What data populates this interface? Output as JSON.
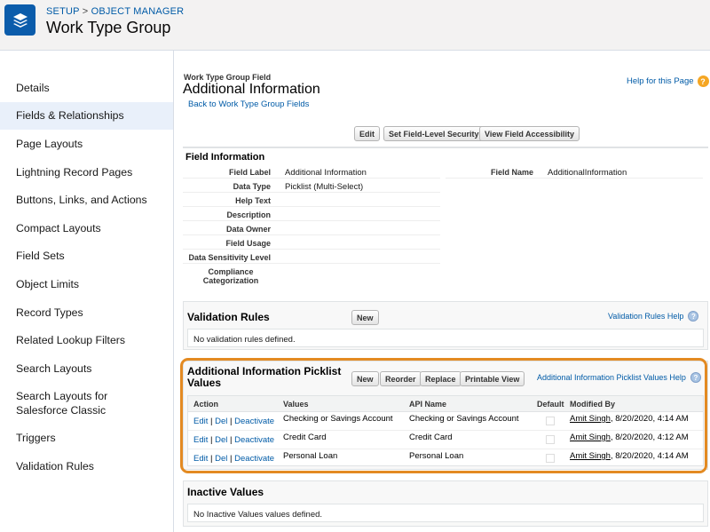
{
  "header": {
    "breadcrumb_setup": "SETUP",
    "breadcrumb_sep": ">",
    "breadcrumb_object_manager": "OBJECT MANAGER",
    "title": "Work Type Group",
    "icon": "layers-icon",
    "icon_color": "#0b5cab"
  },
  "sidebar": {
    "items": [
      {
        "label": "Details"
      },
      {
        "label": "Fields & Relationships"
      },
      {
        "label": "Page Layouts"
      },
      {
        "label": "Lightning Record Pages"
      },
      {
        "label": "Buttons, Links, and Actions"
      },
      {
        "label": "Compact Layouts"
      },
      {
        "label": "Field Sets"
      },
      {
        "label": "Object Limits"
      },
      {
        "label": "Record Types"
      },
      {
        "label": "Related Lookup Filters"
      },
      {
        "label": "Search Layouts"
      },
      {
        "label": "Search Layouts for Salesforce Classic"
      },
      {
        "label": "Triggers"
      },
      {
        "label": "Validation Rules"
      }
    ],
    "active": "Fields & Relationships"
  },
  "main": {
    "caption": "Work Type Group Field",
    "title": "Additional Information",
    "back_link": "Back to Work Type Group Fields",
    "help_link": "Help for this Page",
    "help_icon": "help-orange-icon",
    "buttons": {
      "edit": "Edit",
      "set_fls": "Set Field-Level Security",
      "view_access": "View Field Accessibility"
    }
  },
  "field_info": {
    "title": "Field Information",
    "rows": [
      {
        "label": "Field Label",
        "value": "Additional Information"
      },
      {
        "label": "Data Type",
        "value": "Picklist (Multi-Select)"
      },
      {
        "label": "Help Text",
        "value": ""
      },
      {
        "label": "Description",
        "value": ""
      },
      {
        "label": "Data Owner",
        "value": ""
      },
      {
        "label": "Field Usage",
        "value": ""
      },
      {
        "label": "Data Sensitivity Level",
        "value": ""
      },
      {
        "label": "Compliance Categorization",
        "value": ""
      }
    ],
    "field_name_label": "Field Name",
    "field_name_value": "AdditionalInformation"
  },
  "validation_rules": {
    "title": "Validation Rules",
    "new_button": "New",
    "help_link": "Validation Rules Help",
    "empty_text": "No validation rules defined."
  },
  "picklist": {
    "title_line1": "Additional Information Picklist",
    "title_line2": "Values",
    "buttons": {
      "new": "New",
      "reorder": "Reorder",
      "replace": "Replace",
      "printable": "Printable View"
    },
    "help_link": "Additional Information Picklist Values Help",
    "columns": [
      "Action",
      "Values",
      "API Name",
      "Default",
      "Modified By"
    ],
    "action_links": {
      "edit": "Edit",
      "del": "Del",
      "deactivate": "Deactivate",
      "sep": "|"
    },
    "rows": [
      {
        "value": "Checking or Savings Account",
        "api_name": "Checking or Savings Account",
        "default": false,
        "modified_user": "Amit Singh",
        "modified_date": ", 8/20/2020, 4:14 AM"
      },
      {
        "value": "Credit Card",
        "api_name": "Credit Card",
        "default": false,
        "modified_user": "Amit Singh",
        "modified_date": ", 8/20/2020, 4:12 AM"
      },
      {
        "value": "Personal Loan",
        "api_name": "Personal Loan",
        "default": false,
        "modified_user": "Amit Singh",
        "modified_date": ", 8/20/2020, 4:14 AM"
      }
    ],
    "highlight_color": "#e38a22"
  },
  "inactive_values": {
    "title": "Inactive Values",
    "empty_text": "No Inactive Values values defined."
  }
}
